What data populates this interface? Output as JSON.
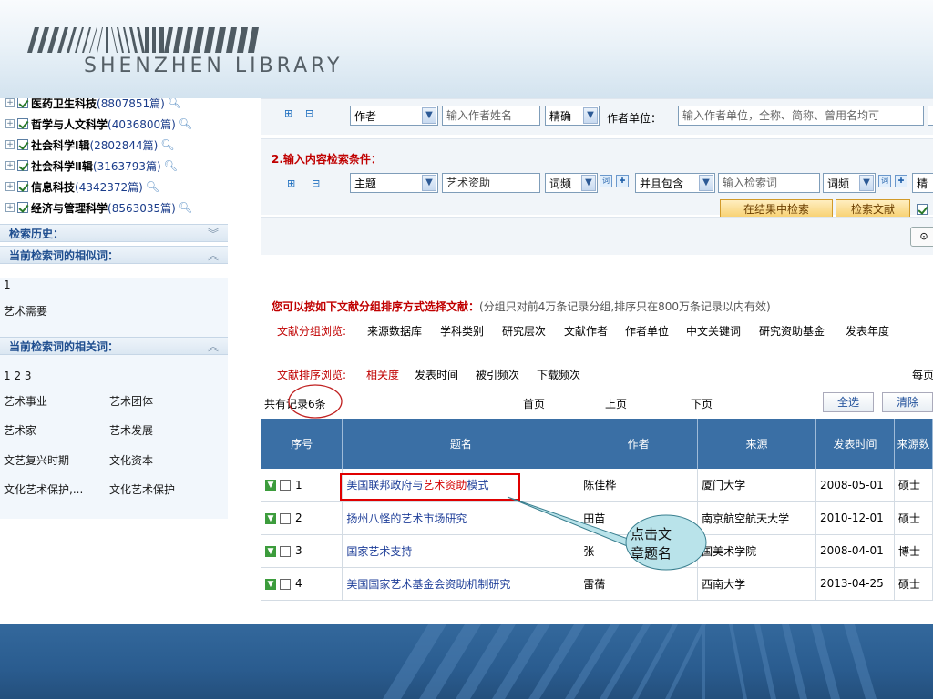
{
  "header": {
    "library_name": "SHENZHEN LIBRARY"
  },
  "databases": [
    {
      "name": "医药卫生科技",
      "count": "(8807851篇)"
    },
    {
      "name": "哲学与人文科学",
      "count": "(4036800篇)"
    },
    {
      "name": "社会科学Ⅰ辑",
      "count": "(2802844篇)"
    },
    {
      "name": "社会科学Ⅱ辑",
      "count": "(3163793篇)"
    },
    {
      "name": "信息科技",
      "count": "(4342372篇)"
    },
    {
      "name": "经济与管理科学",
      "count": "(8563035篇)"
    }
  ],
  "left": {
    "history_title": "检索历史：",
    "similar_title": "当前检索词的相似词：",
    "similar_pages": "1",
    "similar_words": [
      "艺术需要"
    ],
    "related_title": "当前检索词的相关词：",
    "related_pages": "1 2 3",
    "related_words": [
      "艺术事业",
      "艺术团体",
      "艺术家",
      "艺术发展",
      "文艺复兴时期",
      "文化资本",
      "文化艺术保护,...",
      "文化艺术保护"
    ]
  },
  "search": {
    "author_field": "作者",
    "author_placeholder": "输入作者姓名",
    "author_match": "精确",
    "unit_label": "作者单位：",
    "unit_placeholder": "输入作者单位，全称、简称、曾用名均可",
    "content_title": "2.输入内容检索条件：",
    "subject_field": "主题",
    "subject_value": "艺术资助",
    "freq": "词频",
    "logic": "并且包含",
    "keyword_placeholder": "输入检索词",
    "freq2": "词频",
    "tail": "精",
    "search_in_results": "在结果中检索",
    "search_button": "检索文献"
  },
  "grouping": {
    "title": "您可以按如下文献分组排序方式选择文献：",
    "note": "(分组只对前4万条记录分组,排序只在800万条记录以内有效)",
    "group_label": "文献分组浏览:",
    "group_items": [
      "来源数据库",
      "学科类别",
      "研究层次",
      "文献作者",
      "作者单位",
      "中文关键词",
      "研究资助基金",
      "发表年度"
    ],
    "sort_label": "文献排序浏览:",
    "sort_items": [
      "相关度",
      "发表时间",
      "被引频次",
      "下载频次"
    ],
    "per_page": "每页"
  },
  "pager": {
    "total": "共有记录6条",
    "first": "首页",
    "prev": "上页",
    "next": "下页",
    "select_all": "全选",
    "clear": "清除"
  },
  "table": {
    "headers": [
      "序号",
      "题名",
      "作者",
      "来源",
      "发表时间",
      "来源数"
    ],
    "rows": [
      {
        "no": "1",
        "title_a": "美国联邦政府与",
        "title_b": "艺术资助",
        "title_c": "模式",
        "author": "陈佳桦",
        "source": "厦门大学",
        "date": "2008-05-01",
        "type": "硕士"
      },
      {
        "no": "2",
        "title_a": "扬州八怪的艺术市场研究",
        "title_b": "",
        "title_c": "",
        "author": "田苗",
        "source": "南京航空航天大学",
        "date": "2010-12-01",
        "type": "硕士"
      },
      {
        "no": "3",
        "title_a": "国家艺术支持",
        "title_b": "",
        "title_c": "",
        "author": "张",
        "source": "国美术学院",
        "date": "2008-04-01",
        "type": "博士"
      },
      {
        "no": "4",
        "title_a": "美国国家艺术基金会资助机制研究",
        "title_b": "",
        "title_c": "",
        "author": "雷蒨",
        "source": "西南大学",
        "date": "2013-04-25",
        "type": "硕士"
      }
    ]
  },
  "callout": {
    "line1": "点击文",
    "line2": "章题名"
  }
}
